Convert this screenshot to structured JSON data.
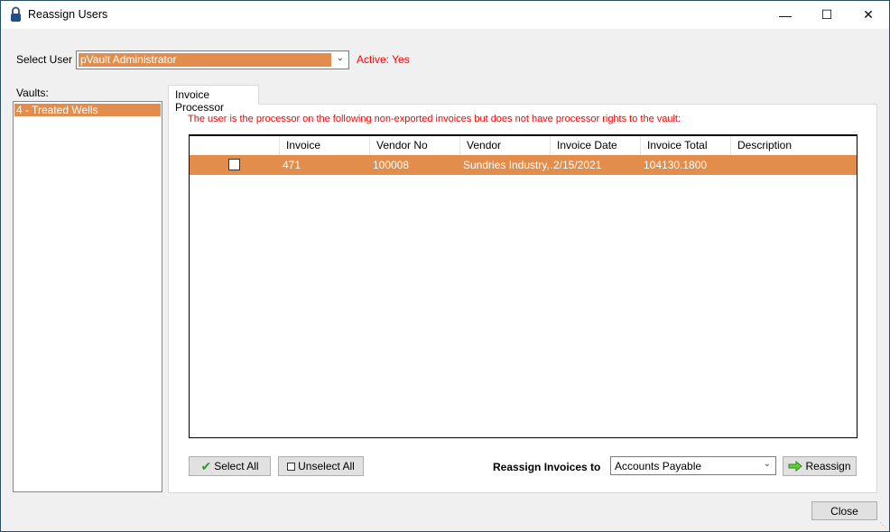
{
  "window": {
    "title": "Reassign Users",
    "minimize": "—",
    "maximize": "☐",
    "close": "✕"
  },
  "select_user": {
    "label": "Select User",
    "value": "pVault Administrator",
    "status": "Active: Yes"
  },
  "vaults": {
    "label": "Vaults:",
    "items": [
      "4 - Treated Wells"
    ]
  },
  "tab": {
    "label": "Invoice Processor"
  },
  "message": "The user is the processor on the following non-exported invoices but does not have processor rights to the vault:",
  "grid": {
    "columns": [
      "",
      "Invoice",
      "Vendor No",
      "Vendor",
      "Invoice Date",
      "Invoice Total",
      "Description"
    ],
    "rows": [
      {
        "checked": false,
        "invoice": "471",
        "vendor_no": "100008",
        "vendor": "Sundries Industry,...",
        "invoice_date": "2/15/2021",
        "invoice_total": "104130.1800",
        "description": ""
      }
    ]
  },
  "buttons": {
    "select_all": "Select All",
    "unselect_all": "Unselect All",
    "reassign": "Reassign",
    "close": "Close"
  },
  "reassign_to": {
    "label": "Reassign Invoices to",
    "value": "Accounts Payable"
  },
  "colors": {
    "selection": "#e38d4c",
    "warning": "#ff0000"
  }
}
